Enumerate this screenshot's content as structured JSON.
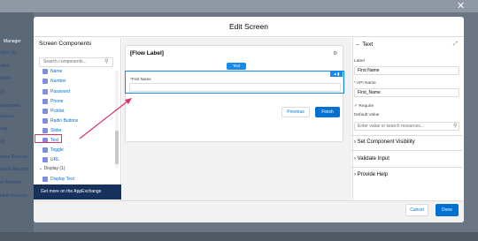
{
  "modal": {
    "title": "Edit Screen",
    "cancel_label": "Cancel",
    "done_label": "Done"
  },
  "background": {
    "manager_label": "Manager",
    "side_items": [
      "s",
      "ction (3)",
      "ction",
      "lFlow",
      "(3)",
      "ssignment",
      "ecision",
      "oop",
      "(4)",
      "reate Records",
      "pdate Records",
      "et Records",
      "elete Records"
    ]
  },
  "left_panel": {
    "title": "Screen Components",
    "search_placeholder": "Search components...",
    "components": [
      "Name",
      "Number",
      "Password",
      "Phone",
      "Picklist",
      "Radio Buttons",
      "Slider",
      "Text",
      "Toggle",
      "URL"
    ],
    "display_group": "Display (1)",
    "display_items": [
      "Display Text"
    ],
    "appexchange": "Get more on the AppExchange"
  },
  "canvas": {
    "flow_label": "[Flow Label]",
    "selected_tag": "Text",
    "field_label": "*First Name",
    "previous_label": "Previous",
    "finish_label": "Finish"
  },
  "right_panel": {
    "title": "Text",
    "label_label": "Label",
    "label_value": "First Name",
    "api_label": "* API Name",
    "api_value": "First_Name",
    "require_label": "Require",
    "default_label": "Default Value",
    "default_placeholder": "Enter value or search resources...",
    "sections": [
      "Set Component Visibility",
      "Validate Input",
      "Provide Help"
    ]
  },
  "colors": {
    "accent": "#0070d2",
    "selection": "#1589ee",
    "highlight": "#d6336c",
    "dark_navy": "#16325c"
  }
}
